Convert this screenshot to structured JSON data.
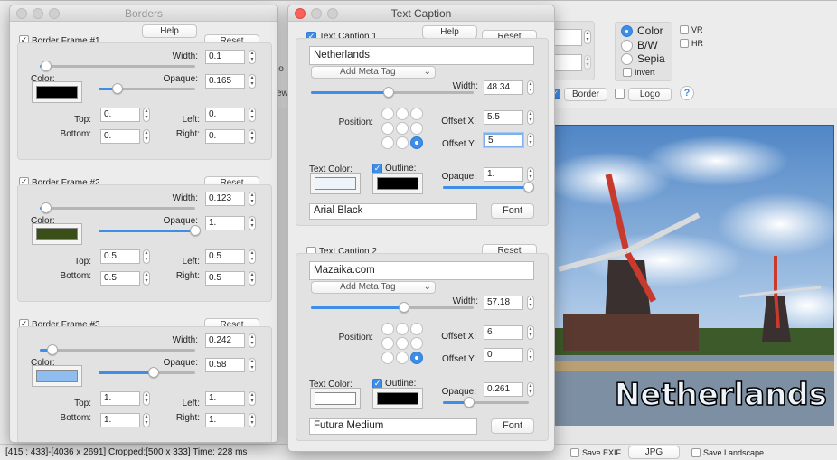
{
  "main": {
    "mode_options": {
      "color": "Color",
      "bw": "B/W",
      "sepia": "Sepia",
      "selected": "Color"
    },
    "invert_label": "Invert",
    "vr_label": "VR",
    "hr_label": "HR",
    "border_button": "Border",
    "logo_button": "Logo",
    "help_icon_label": "?",
    "partial_labels": [
      "io",
      "ew"
    ],
    "save_exif_label": "Save EXIF",
    "jpg_button": "JPG",
    "save_landscape_label": "Save Landscape",
    "status_text": "[415 : 433]-[4036 x 2691]  Cropped:[500 x 333]  Time: 228 ms",
    "photo_caption": "Netherlands"
  },
  "borders": {
    "title": "Borders",
    "help_label": "Help",
    "reset_label": "Reset",
    "labels": {
      "width": "Width:",
      "color": "Color:",
      "opaque": "Opaque:",
      "top": "Top:",
      "bottom": "Bottom:",
      "left": "Left:",
      "right": "Right:"
    },
    "frames": [
      {
        "name": "Border Frame #1",
        "checked": true,
        "width": "0.1",
        "width_pct": 4,
        "opaque": "0.165",
        "opaque_pct": 20,
        "color": "#000000",
        "top": "0.",
        "bottom": "0.",
        "left": "0.",
        "right": "0."
      },
      {
        "name": "Border Frame #2",
        "checked": true,
        "width": "0.123",
        "width_pct": 4,
        "opaque": "1.",
        "opaque_pct": 100,
        "color": "#3a4f17",
        "top": "0.5",
        "bottom": "0.5",
        "left": "0.5",
        "right": "0.5"
      },
      {
        "name": "Border Frame #3",
        "checked": true,
        "width": "0.242",
        "width_pct": 8,
        "opaque": "0.58",
        "opaque_pct": 57,
        "color": "#8fbdf0",
        "top": "1.",
        "bottom": "1.",
        "left": "1.",
        "right": "1."
      }
    ]
  },
  "captions": {
    "title": "Text Caption",
    "help_label": "Help",
    "reset_label": "Reset",
    "labels": {
      "meta": "Add Meta Tag",
      "width": "Width:",
      "position": "Position:",
      "offset_x": "Offset X:",
      "offset_y": "Offset Y:",
      "text_color": "Text Color:",
      "outline": "Outline:",
      "opaque": "Opaque:",
      "font_button": "Font"
    },
    "items": [
      {
        "name": "Text Caption 1",
        "checked": true,
        "text": "Netherlands",
        "width": "48.34",
        "width_pct": 48,
        "offset_x": "5.5",
        "offset_y": "5",
        "position": 8,
        "text_color": "#eef4fb",
        "outline": true,
        "outline_color": "#000000",
        "opaque": "1.",
        "opaque_pct": 100,
        "font": "Arial Black"
      },
      {
        "name": "Text Caption 2",
        "checked": false,
        "text": "Mazaika.com",
        "width": "57.18",
        "width_pct": 57,
        "offset_x": "6",
        "offset_y": "0",
        "position": 8,
        "text_color": "#ffffff",
        "outline": true,
        "outline_color": "#000000",
        "opaque": "0.261",
        "opaque_pct": 30,
        "font": "Futura Medium"
      }
    ]
  }
}
